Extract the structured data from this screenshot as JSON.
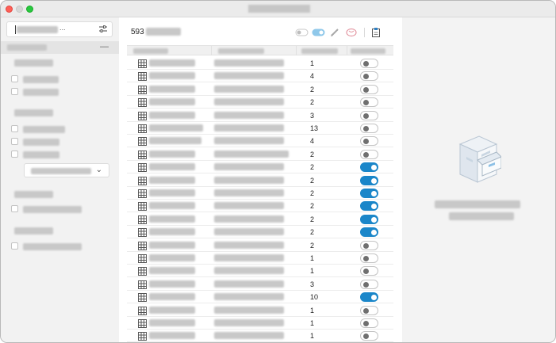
{
  "window": {
    "title": "Lorem Ipsum",
    "buttons": [
      "close",
      "minimize",
      "zoom"
    ]
  },
  "sidebar": {
    "search": {
      "placeholder": "Filter ...",
      "icon": "sliders-icon"
    },
    "section": {
      "label": "Filters",
      "collapse_glyph": "—"
    },
    "groups": [
      {
        "title": "Status",
        "items": [
          "Enabled",
          "Disabled"
        ]
      },
      {
        "title": "Kind",
        "items": [
          "Template",
          "Built-in",
          "Custom"
        ],
        "dropdown": {
          "value": "All selected"
        }
      },
      {
        "title": "Source",
        "items": [
          "Shared component"
        ]
      },
      {
        "title": "Usage",
        "items": [
          "Used in workspace"
        ]
      }
    ]
  },
  "main": {
    "count_number": "593",
    "count_label": "items",
    "toolbar": [
      "toggle-all-icon",
      "switch-icon",
      "edit-icon",
      "brain-icon",
      "clipboard-icon"
    ],
    "columns": [
      "Name",
      "Description",
      "Count",
      "Enabled"
    ],
    "rows": [
      {
        "count": "1",
        "enabled": false
      },
      {
        "count": "4",
        "enabled": false
      },
      {
        "count": "2",
        "enabled": false
      },
      {
        "count": "2",
        "enabled": false
      },
      {
        "count": "3",
        "enabled": false
      },
      {
        "count": "13",
        "enabled": false
      },
      {
        "count": "4",
        "enabled": false
      },
      {
        "count": "2",
        "enabled": false
      },
      {
        "count": "2",
        "enabled": true
      },
      {
        "count": "2",
        "enabled": true
      },
      {
        "count": "2",
        "enabled": true
      },
      {
        "count": "2",
        "enabled": true
      },
      {
        "count": "2",
        "enabled": true
      },
      {
        "count": "2",
        "enabled": true
      },
      {
        "count": "2",
        "enabled": false
      },
      {
        "count": "1",
        "enabled": false
      },
      {
        "count": "1",
        "enabled": false
      },
      {
        "count": "3",
        "enabled": false
      },
      {
        "count": "10",
        "enabled": true
      },
      {
        "count": "1",
        "enabled": false
      },
      {
        "count": "1",
        "enabled": false
      },
      {
        "count": "1",
        "enabled": false
      }
    ]
  },
  "empty_state": {
    "icon": "filing-cabinet-icon",
    "line1": "No item selected",
    "line2": "Select an item"
  },
  "colors": {
    "accent": "#1a86c9",
    "close": "#fe5f57",
    "zoom": "#28c840"
  }
}
